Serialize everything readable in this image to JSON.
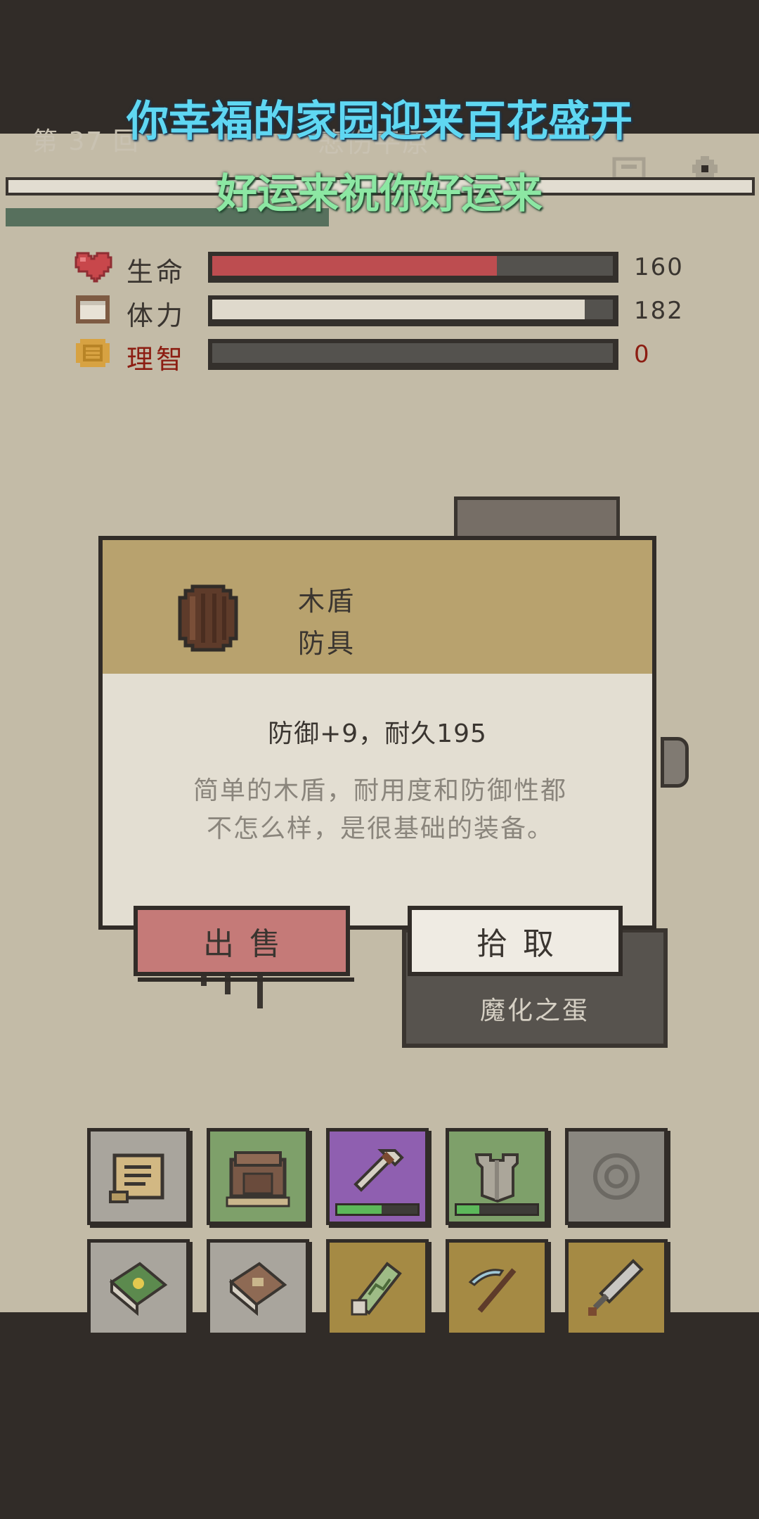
{
  "header": {
    "round_label": "第 37 回",
    "location": "悲伤平原",
    "icons": [
      "map-icon",
      "settings-icon"
    ]
  },
  "lyrics": {
    "line1": "你幸福的家园迎来百花盛开",
    "line2": "好运来祝你好运来"
  },
  "stats": [
    {
      "key": "hp",
      "label": "生命",
      "value": "160",
      "fill_pct": 71,
      "fill_color": "#bd4d50",
      "label_color": "#3a3530",
      "icon": "heart-icon"
    },
    {
      "key": "stamina",
      "label": "体力",
      "value": "182",
      "fill_pct": 93,
      "fill_color": "#dfd9cc",
      "label_color": "#3a3530",
      "icon": "bread-icon"
    },
    {
      "key": "sanity",
      "label": "理智",
      "value": "0",
      "fill_pct": 0,
      "fill_color": "#54524e",
      "label_color": "#8c1d12",
      "icon": "coin-icon"
    }
  ],
  "popup": {
    "item_name": "木盾",
    "item_type": "防具",
    "item_stats": "防御+9，耐久195",
    "item_desc_line1": "简单的木盾，耐用度和防御性都",
    "item_desc_line2": "不怎么样，是很基础的装备。",
    "sell_label": "出售",
    "pickup_label": "拾取"
  },
  "background": {
    "egg_label": "魔化之蛋"
  },
  "inventory": {
    "row1": [
      {
        "name": "scroll-icon",
        "bg": "#a9a59d",
        "durability": null
      },
      {
        "name": "backpack-icon",
        "bg": "#7ea06a",
        "durability": null
      },
      {
        "name": "dagger-icon",
        "bg": "#8f5fb0",
        "durability": 0.55
      },
      {
        "name": "armor-icon",
        "bg": "#7ea06a",
        "durability": 0.28
      },
      {
        "name": "empty-slot-icon",
        "bg": "#8a8780",
        "durability": null
      }
    ],
    "row2": [
      {
        "name": "green-book-icon",
        "bg": "#a9a59d"
      },
      {
        "name": "brown-book-icon",
        "bg": "#a9a59d"
      },
      {
        "name": "map-scroll-icon",
        "bg": "#a58a44"
      },
      {
        "name": "pickaxe-icon",
        "bg": "#a58a44"
      },
      {
        "name": "sword-icon",
        "bg": "#a58a44"
      }
    ]
  }
}
